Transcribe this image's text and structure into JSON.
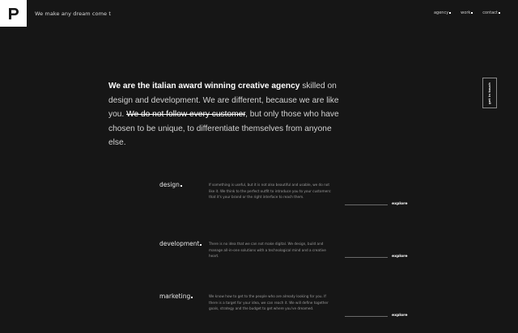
{
  "header": {
    "logo_letter": "P",
    "tagline": "We make any dream come t",
    "nav": [
      "agency",
      "work",
      "contact"
    ]
  },
  "hero": {
    "bold_intro": "We are the italian award winning creative agency",
    "text_a": " skilled on design and development. We are different, because we are like you. ",
    "strike": "We do not follow every customer",
    "text_b": ", but only those who have chosen to be unique, to differentiate themselves from anyone else."
  },
  "side_tab": {
    "label": "get in touch"
  },
  "services": [
    {
      "title": "design",
      "description": "If something is useful, but it is not also beautiful and usable, we do not like it. We think to the perfect outfit to introduce you to your customers: that it's your brand or the right interface to reach them.",
      "link": "explore"
    },
    {
      "title": "development",
      "description": "There is no idea that we can not make digital. We design, build and manage all-in-one solutions with a technological mind and a creative heart.",
      "link": "explore"
    },
    {
      "title": "marketing",
      "description": "We know how to get to the people who are already looking for you. If there is a target for your idea, we can reach it. We will define together goals, strategy and the budget to get where you've dreamed.",
      "link": "explore"
    }
  ]
}
